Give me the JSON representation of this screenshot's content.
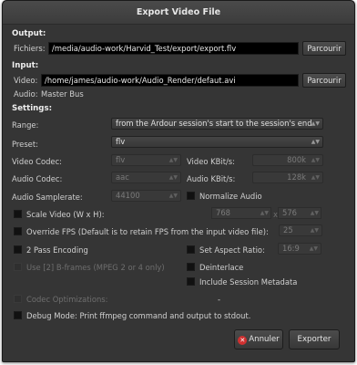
{
  "window": {
    "title": "Export Video File"
  },
  "output": {
    "heading": "Output:",
    "file_label": "Fichiers:",
    "file_value": "/media/audio-work/Harvid_Test/export/export.flv",
    "browse_label": "Parcourir"
  },
  "input": {
    "heading": "Input:",
    "video_label": "Video:",
    "video_value": "/home/james/audio-work/Audio_Render/defaut.avi",
    "browse_label": "Parcourir",
    "audio_label": "Audio:",
    "audio_value": "Master Bus"
  },
  "settings": {
    "heading": "Settings:",
    "range_label": "Range:",
    "range_value": "from the Ardour session's start to the session's end",
    "preset_label": "Preset:",
    "preset_value": "flv",
    "video_codec_label": "Video Codec:",
    "video_codec_value": "flv",
    "video_kbits_label": "Video KBit/s:",
    "video_kbits_value": "800k",
    "audio_codec_label": "Audio Codec:",
    "audio_codec_value": "aac",
    "audio_kbits_label": "Audio KBit/s:",
    "audio_kbits_value": "128k",
    "samplerate_label": "Audio Samplerate:",
    "samplerate_value": "44100",
    "normalize_label": "Normalize Audio",
    "scale_label": "Scale Video (W x H):",
    "scale_w": "768",
    "scale_h": "576",
    "override_fps_label": "Override FPS (Default is to retain FPS from the input video file):",
    "fps_value": "25",
    "two_pass_label": "2 Pass Encoding",
    "aspect_label": "Set Aspect Ratio:",
    "aspect_value": "16:9",
    "bframes_label": "Use [2] B-frames (MPEG 2 or 4 only)",
    "deinterlace_label": "Deinterlace",
    "metadata_label": "Include Session Metadata",
    "codec_opt_label": "Codec Optimizations:",
    "codec_opt_value": "-",
    "debug_label": "Debug Mode: Print ffmpeg command and output to stdout."
  },
  "actions": {
    "cancel_label": "Annuler",
    "export_label": "Exporter"
  }
}
